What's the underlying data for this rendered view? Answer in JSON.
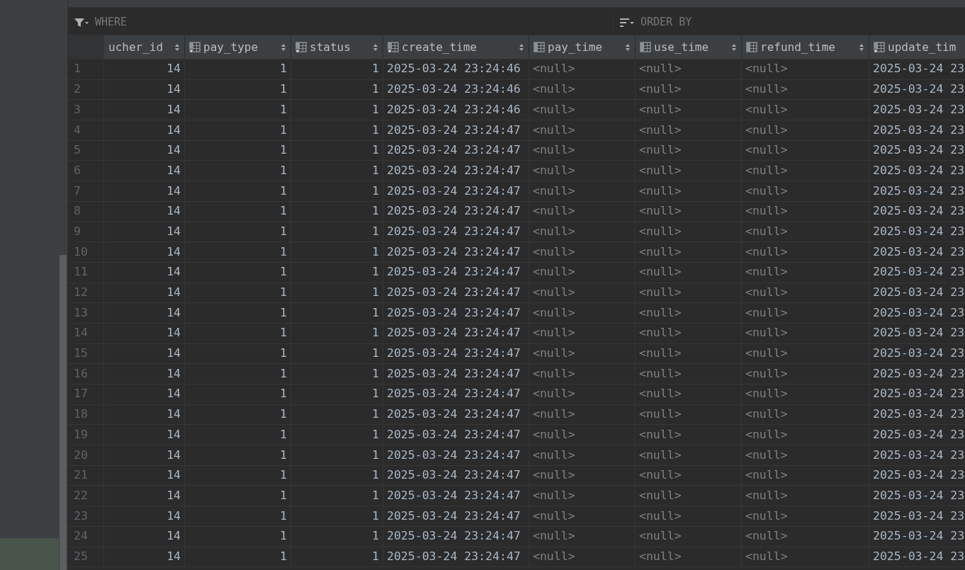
{
  "filter_bar": {
    "where": "WHERE",
    "order_by": "ORDER BY"
  },
  "table": {
    "columns": [
      {
        "name": "ucher_id",
        "kind": "number"
      },
      {
        "name": "pay_type",
        "kind": "number",
        "indexed": true
      },
      {
        "name": "status",
        "kind": "number",
        "indexed": true
      },
      {
        "name": "create_time",
        "kind": "datetime",
        "indexed": true
      },
      {
        "name": "pay_time",
        "kind": "empty",
        "indexed": false
      },
      {
        "name": "use_time",
        "kind": "empty",
        "indexed": false
      },
      {
        "name": "refund_time",
        "kind": "empty",
        "indexed": false
      },
      {
        "name": "update_tim",
        "kind": "datetime",
        "indexed": true
      }
    ],
    "rows": [
      {
        "number": "1",
        "cells": [
          "14",
          "1",
          "1",
          "2025-03-24 23:24:46",
          "<null>",
          "<null>",
          "<null>",
          "2025-03-24 23"
        ]
      },
      {
        "number": "2",
        "cells": [
          "14",
          "1",
          "1",
          "2025-03-24 23:24:46",
          "<null>",
          "<null>",
          "<null>",
          "2025-03-24 23"
        ]
      },
      {
        "number": "3",
        "cells": [
          "14",
          "1",
          "1",
          "2025-03-24 23:24:46",
          "<null>",
          "<null>",
          "<null>",
          "2025-03-24 23"
        ]
      },
      {
        "number": "4",
        "cells": [
          "14",
          "1",
          "1",
          "2025-03-24 23:24:47",
          "<null>",
          "<null>",
          "<null>",
          "2025-03-24 23"
        ]
      },
      {
        "number": "5",
        "cells": [
          "14",
          "1",
          "1",
          "2025-03-24 23:24:47",
          "<null>",
          "<null>",
          "<null>",
          "2025-03-24 23"
        ]
      },
      {
        "number": "6",
        "cells": [
          "14",
          "1",
          "1",
          "2025-03-24 23:24:47",
          "<null>",
          "<null>",
          "<null>",
          "2025-03-24 23"
        ]
      },
      {
        "number": "7",
        "cells": [
          "14",
          "1",
          "1",
          "2025-03-24 23:24:47",
          "<null>",
          "<null>",
          "<null>",
          "2025-03-24 23"
        ]
      },
      {
        "number": "8",
        "cells": [
          "14",
          "1",
          "1",
          "2025-03-24 23:24:47",
          "<null>",
          "<null>",
          "<null>",
          "2025-03-24 23"
        ]
      },
      {
        "number": "9",
        "cells": [
          "14",
          "1",
          "1",
          "2025-03-24 23:24:47",
          "<null>",
          "<null>",
          "<null>",
          "2025-03-24 23"
        ]
      },
      {
        "number": "10",
        "cells": [
          "14",
          "1",
          "1",
          "2025-03-24 23:24:47",
          "<null>",
          "<null>",
          "<null>",
          "2025-03-24 23"
        ]
      },
      {
        "number": "11",
        "cells": [
          "14",
          "1",
          "1",
          "2025-03-24 23:24:47",
          "<null>",
          "<null>",
          "<null>",
          "2025-03-24 23"
        ]
      },
      {
        "number": "12",
        "cells": [
          "14",
          "1",
          "1",
          "2025-03-24 23:24:47",
          "<null>",
          "<null>",
          "<null>",
          "2025-03-24 23"
        ]
      },
      {
        "number": "13",
        "cells": [
          "14",
          "1",
          "1",
          "2025-03-24 23:24:47",
          "<null>",
          "<null>",
          "<null>",
          "2025-03-24 23"
        ]
      },
      {
        "number": "14",
        "cells": [
          "14",
          "1",
          "1",
          "2025-03-24 23:24:47",
          "<null>",
          "<null>",
          "<null>",
          "2025-03-24 23"
        ]
      },
      {
        "number": "15",
        "cells": [
          "14",
          "1",
          "1",
          "2025-03-24 23:24:47",
          "<null>",
          "<null>",
          "<null>",
          "2025-03-24 23"
        ]
      },
      {
        "number": "16",
        "cells": [
          "14",
          "1",
          "1",
          "2025-03-24 23:24:47",
          "<null>",
          "<null>",
          "<null>",
          "2025-03-24 23"
        ]
      },
      {
        "number": "17",
        "cells": [
          "14",
          "1",
          "1",
          "2025-03-24 23:24:47",
          "<null>",
          "<null>",
          "<null>",
          "2025-03-24 23"
        ]
      },
      {
        "number": "18",
        "cells": [
          "14",
          "1",
          "1",
          "2025-03-24 23:24:47",
          "<null>",
          "<null>",
          "<null>",
          "2025-03-24 23"
        ]
      },
      {
        "number": "19",
        "cells": [
          "14",
          "1",
          "1",
          "2025-03-24 23:24:47",
          "<null>",
          "<null>",
          "<null>",
          "2025-03-24 23"
        ]
      },
      {
        "number": "20",
        "cells": [
          "14",
          "1",
          "1",
          "2025-03-24 23:24:47",
          "<null>",
          "<null>",
          "<null>",
          "2025-03-24 23"
        ]
      },
      {
        "number": "21",
        "cells": [
          "14",
          "1",
          "1",
          "2025-03-24 23:24:47",
          "<null>",
          "<null>",
          "<null>",
          "2025-03-24 23"
        ]
      },
      {
        "number": "22",
        "cells": [
          "14",
          "1",
          "1",
          "2025-03-24 23:24:47",
          "<null>",
          "<null>",
          "<null>",
          "2025-03-24 23"
        ]
      },
      {
        "number": "23",
        "cells": [
          "14",
          "1",
          "1",
          "2025-03-24 23:24:47",
          "<null>",
          "<null>",
          "<null>",
          "2025-03-24 23"
        ]
      },
      {
        "number": "24",
        "cells": [
          "14",
          "1",
          "1",
          "2025-03-24 23:24:47",
          "<null>",
          "<null>",
          "<null>",
          "2025-03-24 23"
        ]
      },
      {
        "number": "25",
        "cells": [
          "14",
          "1",
          "1",
          "2025-03-24 23:24:47",
          "<null>",
          "<null>",
          "<null>",
          "2025-03-24 23"
        ]
      }
    ]
  }
}
